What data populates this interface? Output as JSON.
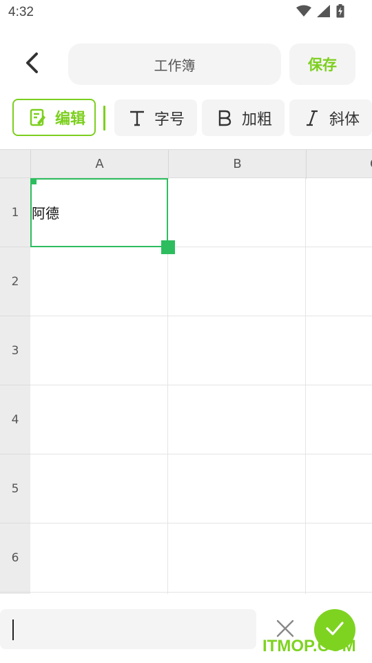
{
  "status_bar": {
    "time": "4:32"
  },
  "header": {
    "title": "工作簿",
    "save_label": "保存"
  },
  "toolbar": {
    "edit_label": "编辑",
    "font_size_label": "字号",
    "bold_label": "加粗",
    "italic_label": "斜体"
  },
  "sheet": {
    "columns": [
      "A",
      "B",
      "C"
    ],
    "rows": [
      "1",
      "2",
      "3",
      "4",
      "5",
      "6"
    ],
    "cells": {
      "A1": "阿德"
    },
    "selected_cell": "A1"
  },
  "formula_bar": {
    "value": "",
    "placeholder": ""
  },
  "watermark": "ITMOP.COM",
  "colors": {
    "accent": "#7ccf1e",
    "selection": "#2dbd5e",
    "confirm": "#7ed321"
  }
}
